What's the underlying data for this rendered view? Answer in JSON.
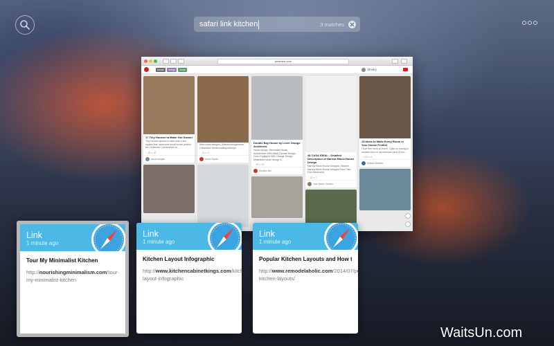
{
  "search": {
    "query": "safari link kitchen",
    "match_count": "3 matches"
  },
  "browser": {
    "address": "pinterest.com",
    "guides": [
      {
        "label": "house",
        "color": "#6b6b6b"
      },
      {
        "label": "design",
        "color": "#8b7bb5"
      },
      {
        "label": "ideas",
        "color": "#5a9a6a"
      }
    ],
    "user_name": "Dmitry",
    "columns": [
      [
        {
          "photo": "#9a7a5e",
          "photo_h": 84,
          "title": "17 Tiny Houses to Make You Swoon",
          "desc": "Tiny houses spread to take care a few square feet, awesome small house perfect for Christmas! | snowwriter.co...",
          "meta": "♡ 50  ↻ 30",
          "user": "jacob carrigan",
          "user_sub": "House Ideas",
          "av": "#7a8aa0"
        },
        {
          "photo": "#7b6e6a",
          "photo_h": 70,
          "title": "",
          "desc": "",
          "meta": "",
          "user": "",
          "user_sub": "",
          "av": ""
        }
      ],
      [
        {
          "photo": "#8a6a4a",
          "photo_h": 96,
          "title": "",
          "desc": "Main room designs | Walnutcrdingsmentz... | #Mansion #redecorating #design",
          "meta": "♡ 24  ↻ 6",
          "user": "Noah Clayton",
          "user_sub": "Drafts",
          "av": "#c0392b"
        },
        {
          "photo": "#d4d8dc",
          "photo_h": 90,
          "title": "",
          "desc": "",
          "meta": "",
          "user": "",
          "user_sub": "",
          "av": ""
        }
      ],
      [
        {
          "photo": "#b9bdc0",
          "photo_h": 92,
          "title": "Double Bay House by Level Orange Architects",
          "desc": "Home design, Minimalist House Architecture With Black Facade Design Color Equipped With Garage Design Minimalist house design a...",
          "meta": "♡ 59  ↻ 15",
          "user": "Gustavo Mel",
          "user_sub": "home",
          "av": "#c0392b"
        },
        {
          "photo": "#a7a39b",
          "photo_h": 60,
          "title": "",
          "desc": "",
          "meta": "",
          "user": "",
          "user_sub": "",
          "av": ""
        }
      ],
      [
        {
          "photo": "#f0f0ee",
          "photo_h": 110,
          "title": "48 CASA IDEAL - Detailed Description of Narrow Block House Design",
          "desc": "Narrow Block House Designs | Modern Narrow Block House Designs Floor Plan Four Bedrooms",
          "meta": "♡ 20  ↻ 7",
          "user": "Joao Mauro Carnero",
          "user_sub": "Design Ideas",
          "av": "#8a7a60"
        },
        {
          "photo": "#5a6a4a",
          "photo_h": 60,
          "title": "",
          "desc": "",
          "meta": "",
          "user": "",
          "user_sub": "",
          "av": ""
        }
      ],
      [
        {
          "photo": "#6a5646",
          "photo_h": 90,
          "title": "15 Ideas to Make Every Room in Your House Prettier",
          "desc": "I love this room so much, I plan on having a wooden floor in my bedroom (and I'll wo...",
          "meta": "♡ 100  ↻ 6",
          "user": "Edward Nemilen",
          "user_sub": "Home",
          "av": "#4a6a8a"
        },
        {
          "photo": "#6a8a9a",
          "photo_h": 60,
          "title": "",
          "desc": "",
          "meta": "",
          "user": "",
          "user_sub": "",
          "av": ""
        }
      ]
    ]
  },
  "results": [
    {
      "type": "Link",
      "time": "1 minute ago",
      "title": "Tour My Minimalist Kitchen",
      "url_prefix": "http://",
      "url_domain": "nourishingminimalism.com",
      "url_path": "/tour-my-minimalist-kitchen"
    },
    {
      "type": "Link",
      "time": "1 minute ago",
      "title": "Kitchen Layout Infographic",
      "url_prefix": "http://",
      "url_domain": "www.kitchencabinetkings.com",
      "url_path": "/kitchen-layout-infographic"
    },
    {
      "type": "Link",
      "time": "1 minute ago",
      "title": "Popular Kitchen Layouts and How t…",
      "url_prefix": "http://",
      "url_domain": "www.remodelaholic.com",
      "url_path": "/2014/07/popular-kitchen-layouts/"
    }
  ],
  "watermark": "WaitsUn.com",
  "colors": {
    "link_header": "#4cb8e6",
    "pinterest_red": "#cb2027",
    "selection_border": "#b8b8b8"
  },
  "icons": {
    "search": "search-icon",
    "clear": "clear-icon",
    "more": "more-icon",
    "app": "safari-compass-icon"
  }
}
